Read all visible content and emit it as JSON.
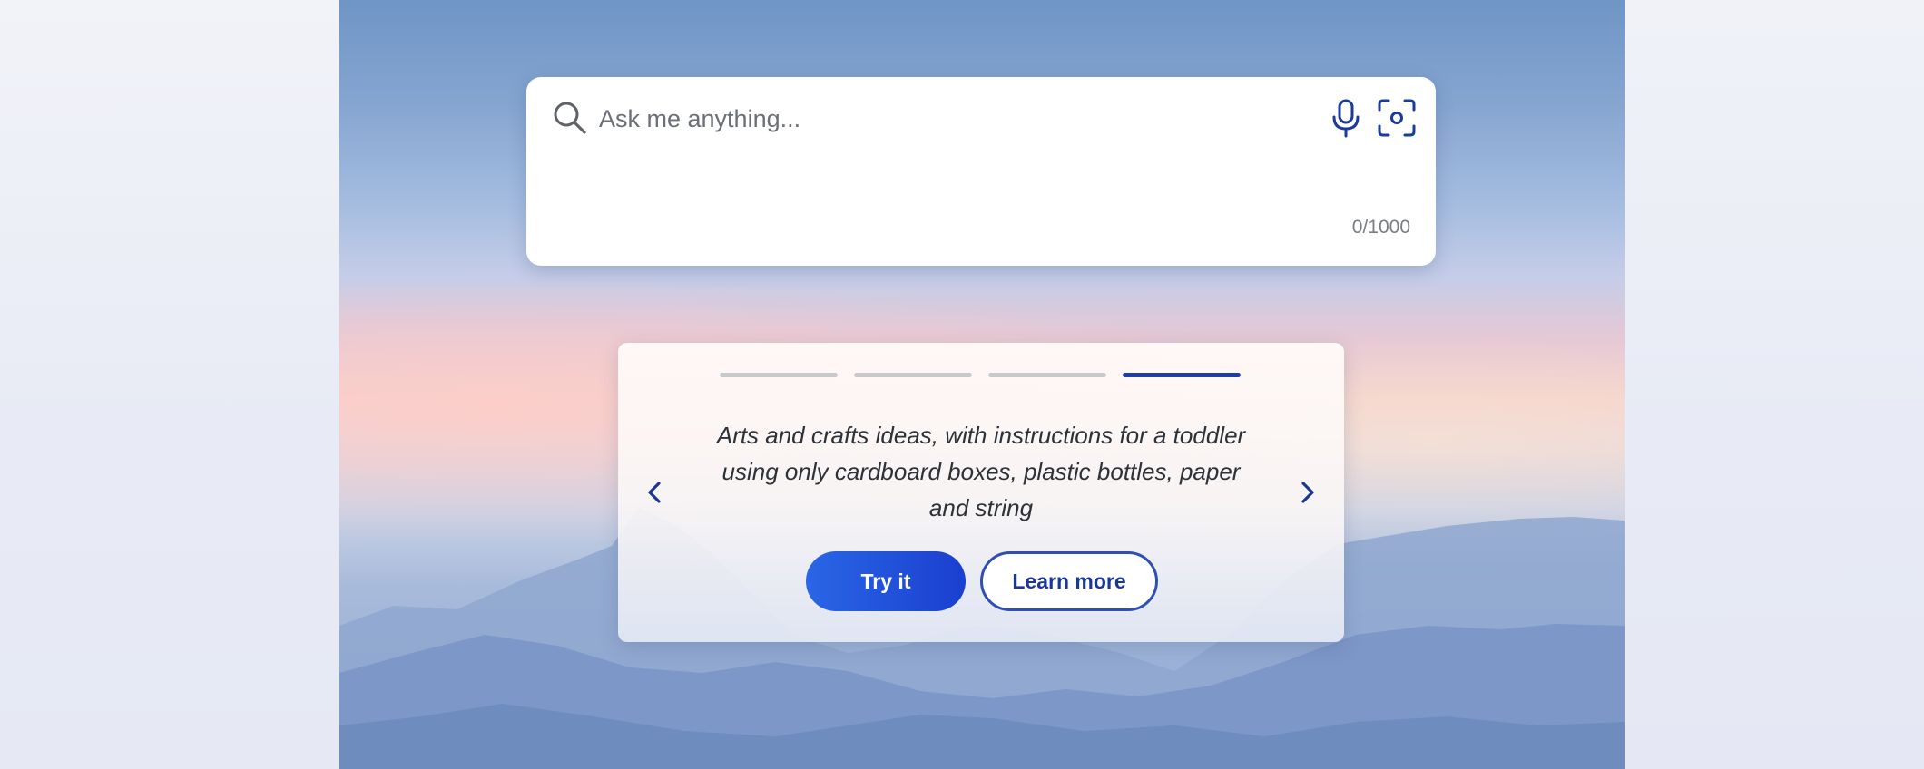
{
  "search": {
    "placeholder": "Ask me anything...",
    "value": "",
    "char_count": "0/1000",
    "icons": [
      "search-icon",
      "microphone-icon",
      "visual-search-icon"
    ]
  },
  "carousel": {
    "slide_count": 4,
    "active_slide": 4,
    "prev_icon": "chevron-left-icon",
    "next_icon": "chevron-right-icon",
    "suggestion": "Arts and crafts ideas, with instructions for a toddler using only cardboard boxes, plastic bottles, paper and string",
    "buttons": {
      "try_label": "Try it",
      "learn_label": "Learn more"
    }
  },
  "colors": {
    "accent": "#1f3fa8",
    "try_button": "#2459dd",
    "icon": "#1a3a9c"
  }
}
